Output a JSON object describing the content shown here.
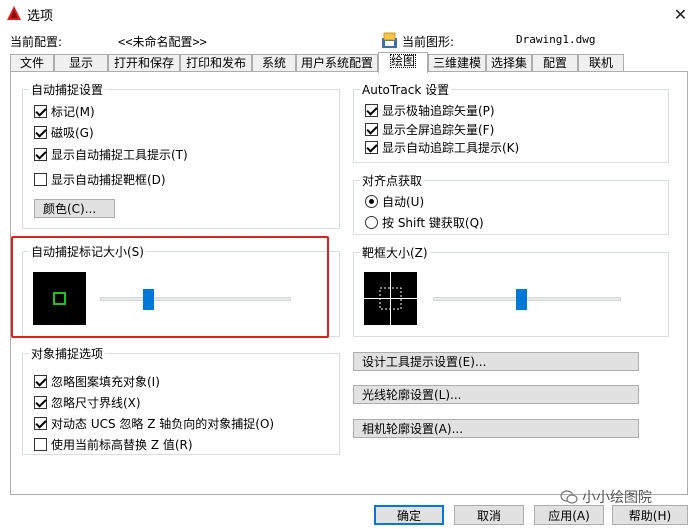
{
  "window": {
    "title": "选项",
    "close_glyph": "✕"
  },
  "header": {
    "profile_label": "当前配置:",
    "profile_value": "<<未命名配置>>",
    "drawing_label": "当前图形:",
    "drawing_value": "Drawing1.dwg"
  },
  "tabs": [
    {
      "label": "文件"
    },
    {
      "label": "显示"
    },
    {
      "label": "打开和保存"
    },
    {
      "label": "打印和发布"
    },
    {
      "label": "系统"
    },
    {
      "label": "用户系统配置"
    },
    {
      "label": "绘图"
    },
    {
      "label": "三维建模"
    },
    {
      "label": "选择集"
    },
    {
      "label": "配置"
    },
    {
      "label": "联机"
    }
  ],
  "active_tab": "绘图",
  "autosnap": {
    "title": "自动捕捉设置",
    "items": [
      {
        "label": "标记(M)",
        "checked": true
      },
      {
        "label": "磁吸(G)",
        "checked": true
      },
      {
        "label": "显示自动捕捉工具提示(T)",
        "checked": true
      },
      {
        "label": "显示自动捕捉靶框(D)",
        "checked": false
      }
    ],
    "color_button": "颜色(C)..."
  },
  "marker_size": {
    "title": "自动捕捉标记大小(S)",
    "level": 0.25
  },
  "osnap_options": {
    "title": "对象捕捉选项",
    "items": [
      {
        "label": "忽略图案填充对象(I)",
        "checked": true
      },
      {
        "label": "忽略尺寸界线(X)",
        "checked": true
      },
      {
        "label": "对动态 UCS 忽略 Z 轴负向的对象捕捉(O)",
        "checked": true
      },
      {
        "label": "使用当前标高替换 Z 值(R)",
        "checked": false
      }
    ]
  },
  "autotrack": {
    "title": "AutoTrack 设置",
    "items": [
      {
        "label": "显示极轴追踪矢量(P)",
        "checked": true
      },
      {
        "label": "显示全屏追踪矢量(F)",
        "checked": true
      },
      {
        "label": "显示自动追踪工具提示(K)",
        "checked": true
      }
    ]
  },
  "alignment": {
    "title": "对齐点获取",
    "options": [
      {
        "label": "自动(U)",
        "selected": true
      },
      {
        "label": "按 Shift 键获取(Q)",
        "selected": false
      }
    ]
  },
  "aperture_size": {
    "title": "靶框大小(Z)",
    "level": 0.47
  },
  "side_buttons": {
    "drafting_tooltip": "设计工具提示设置(E)...",
    "lights_glyph": "光线轮廓设置(L)...",
    "camera_glyph": "相机轮廓设置(A)..."
  },
  "footer": {
    "ok": "确定",
    "cancel": "取消",
    "apply": "应用(A)",
    "help": "帮助(H)"
  },
  "watermark": "小小绘图院",
  "colors": {
    "accent": "#0078d7",
    "highlight": "#e02020",
    "marker_green": "#22c022"
  }
}
